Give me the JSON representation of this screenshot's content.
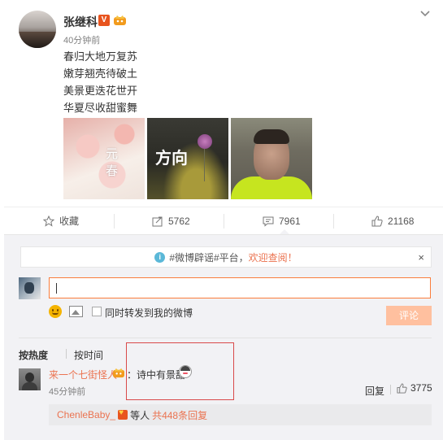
{
  "post": {
    "author": "张继科",
    "time": "40分钟前",
    "verified_badge": "V",
    "poem": [
      "春归大地万复苏",
      "嫩芽翘壳待破土",
      "美景更迭花世开",
      "华夏尽收甜蜜舞"
    ],
    "images": [
      {
        "name": "flower-image",
        "text": "元春"
      },
      {
        "name": "direction-poster-image",
        "text": "方向"
      },
      {
        "name": "portrait-image",
        "text": ""
      }
    ]
  },
  "actions": {
    "favorite": "收藏",
    "share_count": "5762",
    "comment_count": "7961",
    "like_count": "21168"
  },
  "notice": {
    "prefix": "#微博辟谣#平台，",
    "link": "欢迎查阅！",
    "close": "×"
  },
  "composer": {
    "input_value": "",
    "repost_label": "同时转发到我的微博",
    "submit_label": "评论"
  },
  "sort": {
    "hot": "按热度",
    "time": "按时间"
  },
  "comment": {
    "author": "来一个七街怪人",
    "text": "：诗中有景甜",
    "time": "45分钟前",
    "reply_label": "回复",
    "like_count": "3775"
  },
  "reply_summary": {
    "name": "ChenleBaby_",
    "middle": "等人",
    "count": "共448条回复"
  },
  "colors": {
    "accent": "#eb7350",
    "input_border": "#fa7d3c",
    "submit_disabled": "#ffc09f",
    "panel_bg": "#f2f2f5",
    "highlight": "#d94a4a"
  }
}
